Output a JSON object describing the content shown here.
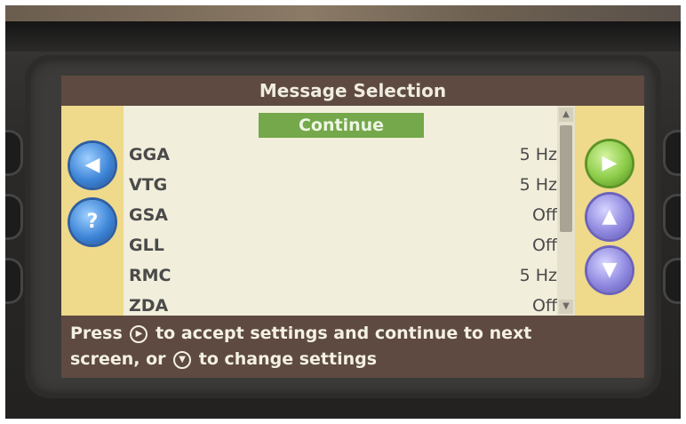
{
  "screen": {
    "title": "Message Selection",
    "continue_label": "Continue",
    "left_buttons": [
      {
        "icon": "back-arrow-icon",
        "glyph": "◀"
      },
      {
        "icon": "help-icon",
        "glyph": "?"
      }
    ],
    "right_buttons": [
      {
        "icon": "forward-arrow-icon",
        "glyph": "▶"
      },
      {
        "icon": "up-arrow-icon",
        "glyph": "▲"
      },
      {
        "icon": "down-arrow-icon",
        "glyph": "▼"
      }
    ],
    "messages": [
      {
        "name": "GGA",
        "rate": "5 Hz"
      },
      {
        "name": "VTG",
        "rate": "5 Hz"
      },
      {
        "name": "GSA",
        "rate": "Off"
      },
      {
        "name": "GLL",
        "rate": "Off"
      },
      {
        "name": "RMC",
        "rate": "5 Hz"
      },
      {
        "name": "ZDA",
        "rate": "Off"
      }
    ],
    "help": {
      "part1": "Press",
      "part2": "to accept settings and continue to next",
      "part3": "screen, or",
      "part4": "to change settings"
    },
    "colors": {
      "title_bg": "#5e4a40",
      "panel_bg": "#efd98a",
      "list_bg": "#f1eedb",
      "continue_bg": "#74a84a"
    }
  }
}
